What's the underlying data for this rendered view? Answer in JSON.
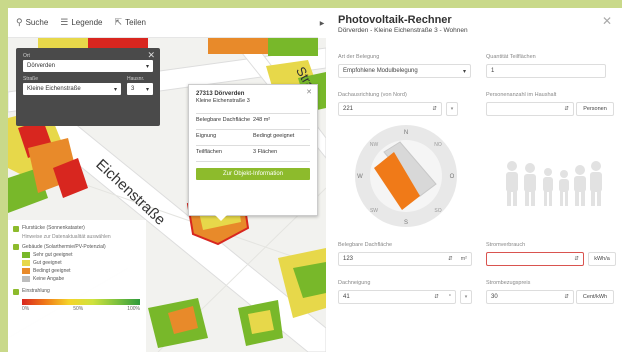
{
  "toolbar": {
    "search": "Suche",
    "legend": "Legende",
    "share": "Teilen"
  },
  "location_panel": {
    "label_top": "Ort",
    "place": "Dörverden",
    "label_street": "Straße",
    "street": "Kleine Eichenstraße",
    "label_no": "Hausnr.",
    "number": "3"
  },
  "popup": {
    "title": "27313 Dörverden",
    "subtitle": "Kleine Eichenstraße 3",
    "rows": [
      {
        "k": "Belegbare Dachfläche",
        "v": "248 m²"
      },
      {
        "k": "Eignung",
        "v": "Bedingt geeignet"
      },
      {
        "k": "Teilflächen",
        "v": "3 Flächen"
      }
    ],
    "button": "Zur Objekt-Information"
  },
  "map": {
    "street_1": "Eichenstraße",
    "street_2": "Stra"
  },
  "legend": {
    "parcels": "Flurstücke (Sonnenkataster)",
    "parcels_sub": "Hinweise zur Datenaktualität auswählen",
    "buildings": "Gebäude (Solarthermie/PV-Potenzial)",
    "items": [
      {
        "label": "Sehr gut geeignet",
        "color": "#78b82a"
      },
      {
        "label": "Gut geeignet",
        "color": "#e7d84a"
      },
      {
        "label": "Bedingt geeignet",
        "color": "#e88a2a"
      },
      {
        "label": "Keine Angabe",
        "color": "#bdbdbd"
      }
    ],
    "radiation": "Einstrahlung",
    "grad_left": "0%",
    "grad_mid": "50%",
    "grad_right": "100%"
  },
  "calc": {
    "title": "Photovoltaik-Rechner",
    "subtitle": "Dörverden - Kleine Eichenstraße 3 - Wohnen",
    "usage_label": "Art der Belegung",
    "usage_value": "Empfohlene Modulbelegung",
    "count_label": "Quantität Teilflächen",
    "count_value": "1",
    "orient_label": "Dachausrichtung (von Nord)",
    "orient_value": "221",
    "persons_label": "Personenanzahl im Haushalt",
    "persons_btn": "Personen",
    "area_label": "Belegbare Dachfläche",
    "area_value": "123",
    "area_unit": "m²",
    "consumption_label": "Stromverbrauch",
    "consumption_btn": "kWh/a",
    "tilt_label": "Dachneigung",
    "tilt_value": "41",
    "tilt_unit": "°",
    "price_label": "Strombezugspreis",
    "price_value": "30",
    "price_btn": "Cent/kWh",
    "compass": {
      "n": "N",
      "ne": "NO",
      "e": "O",
      "se": "SO",
      "s": "S",
      "sw": "SW",
      "w": "W",
      "nw": "NW"
    }
  },
  "colors": {
    "accent": "#8dbb2c",
    "panel_dark": "#4a4a4a",
    "roof_orange": "#f07a18",
    "error": "#d9534f"
  }
}
